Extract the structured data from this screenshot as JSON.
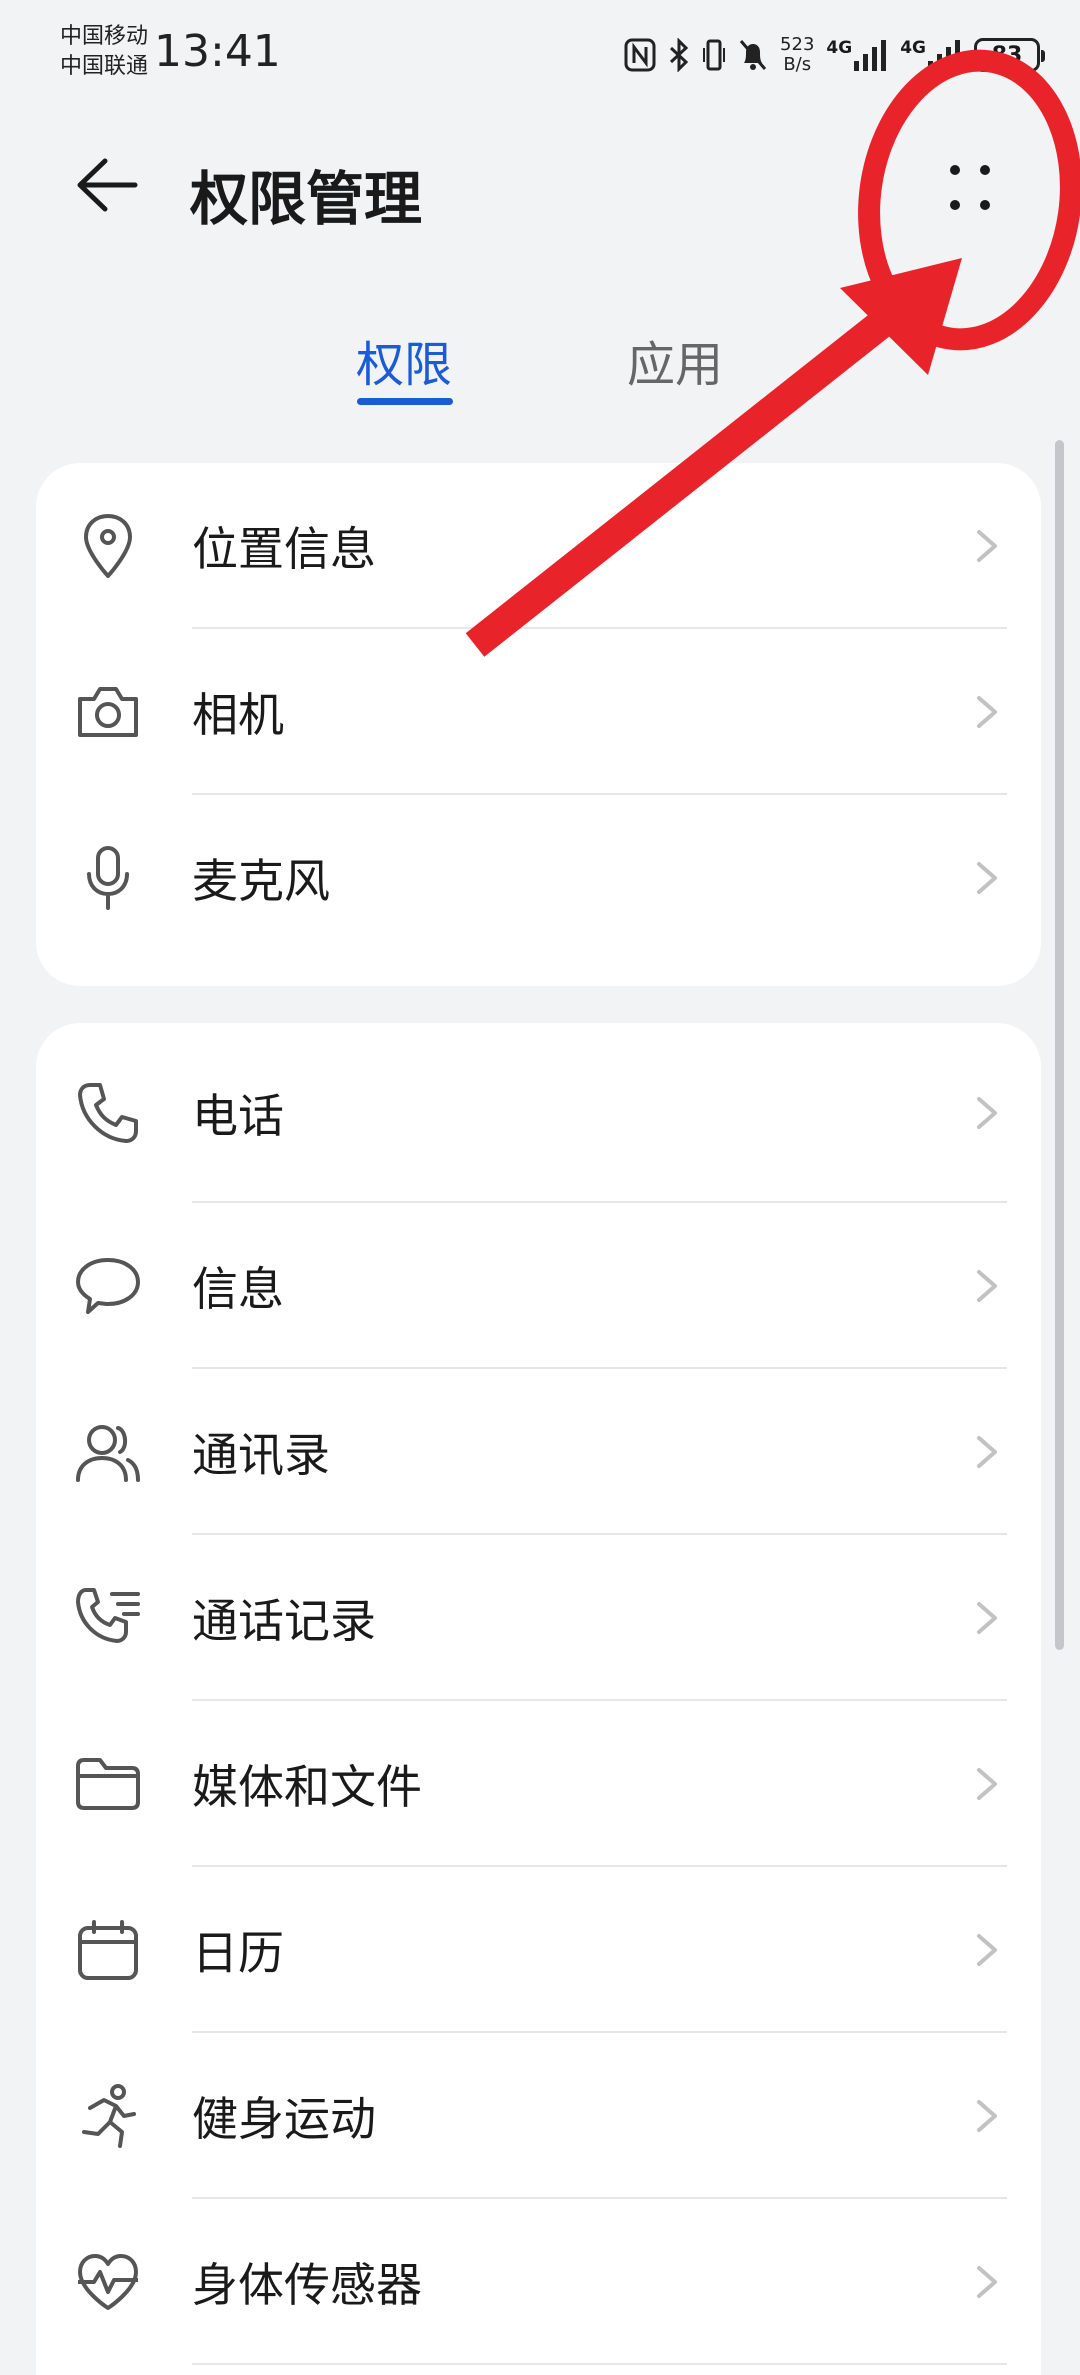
{
  "status_bar": {
    "carrier_1": "中国移动",
    "carrier_2": "中国联通",
    "time": "13:41",
    "net_speed_value": "523",
    "net_speed_unit": "B/s",
    "signal_1": "4G",
    "signal_2": "4G",
    "battery": "83"
  },
  "header": {
    "title": "权限管理"
  },
  "tabs": [
    {
      "label": "权限",
      "active": true
    },
    {
      "label": "应用",
      "active": false
    }
  ],
  "groups": [
    {
      "items": [
        {
          "label": "位置信息",
          "icon": "location-pin-icon"
        },
        {
          "label": "相机",
          "icon": "camera-icon"
        },
        {
          "label": "麦克风",
          "icon": "microphone-icon"
        }
      ]
    },
    {
      "items": [
        {
          "label": "电话",
          "icon": "phone-icon"
        },
        {
          "label": "信息",
          "icon": "message-bubble-icon"
        },
        {
          "label": "通讯录",
          "icon": "contacts-icon"
        },
        {
          "label": "通话记录",
          "icon": "call-log-icon"
        },
        {
          "label": "媒体和文件",
          "icon": "folder-icon"
        },
        {
          "label": "日历",
          "icon": "calendar-icon"
        },
        {
          "label": "健身运动",
          "icon": "running-icon"
        },
        {
          "label": "身体传感器",
          "icon": "heart-rate-icon"
        }
      ]
    }
  ],
  "colors": {
    "accent": "#1b5bd6",
    "background": "#f1f3f5",
    "card": "#ffffff",
    "annotation": "#e8232a"
  }
}
